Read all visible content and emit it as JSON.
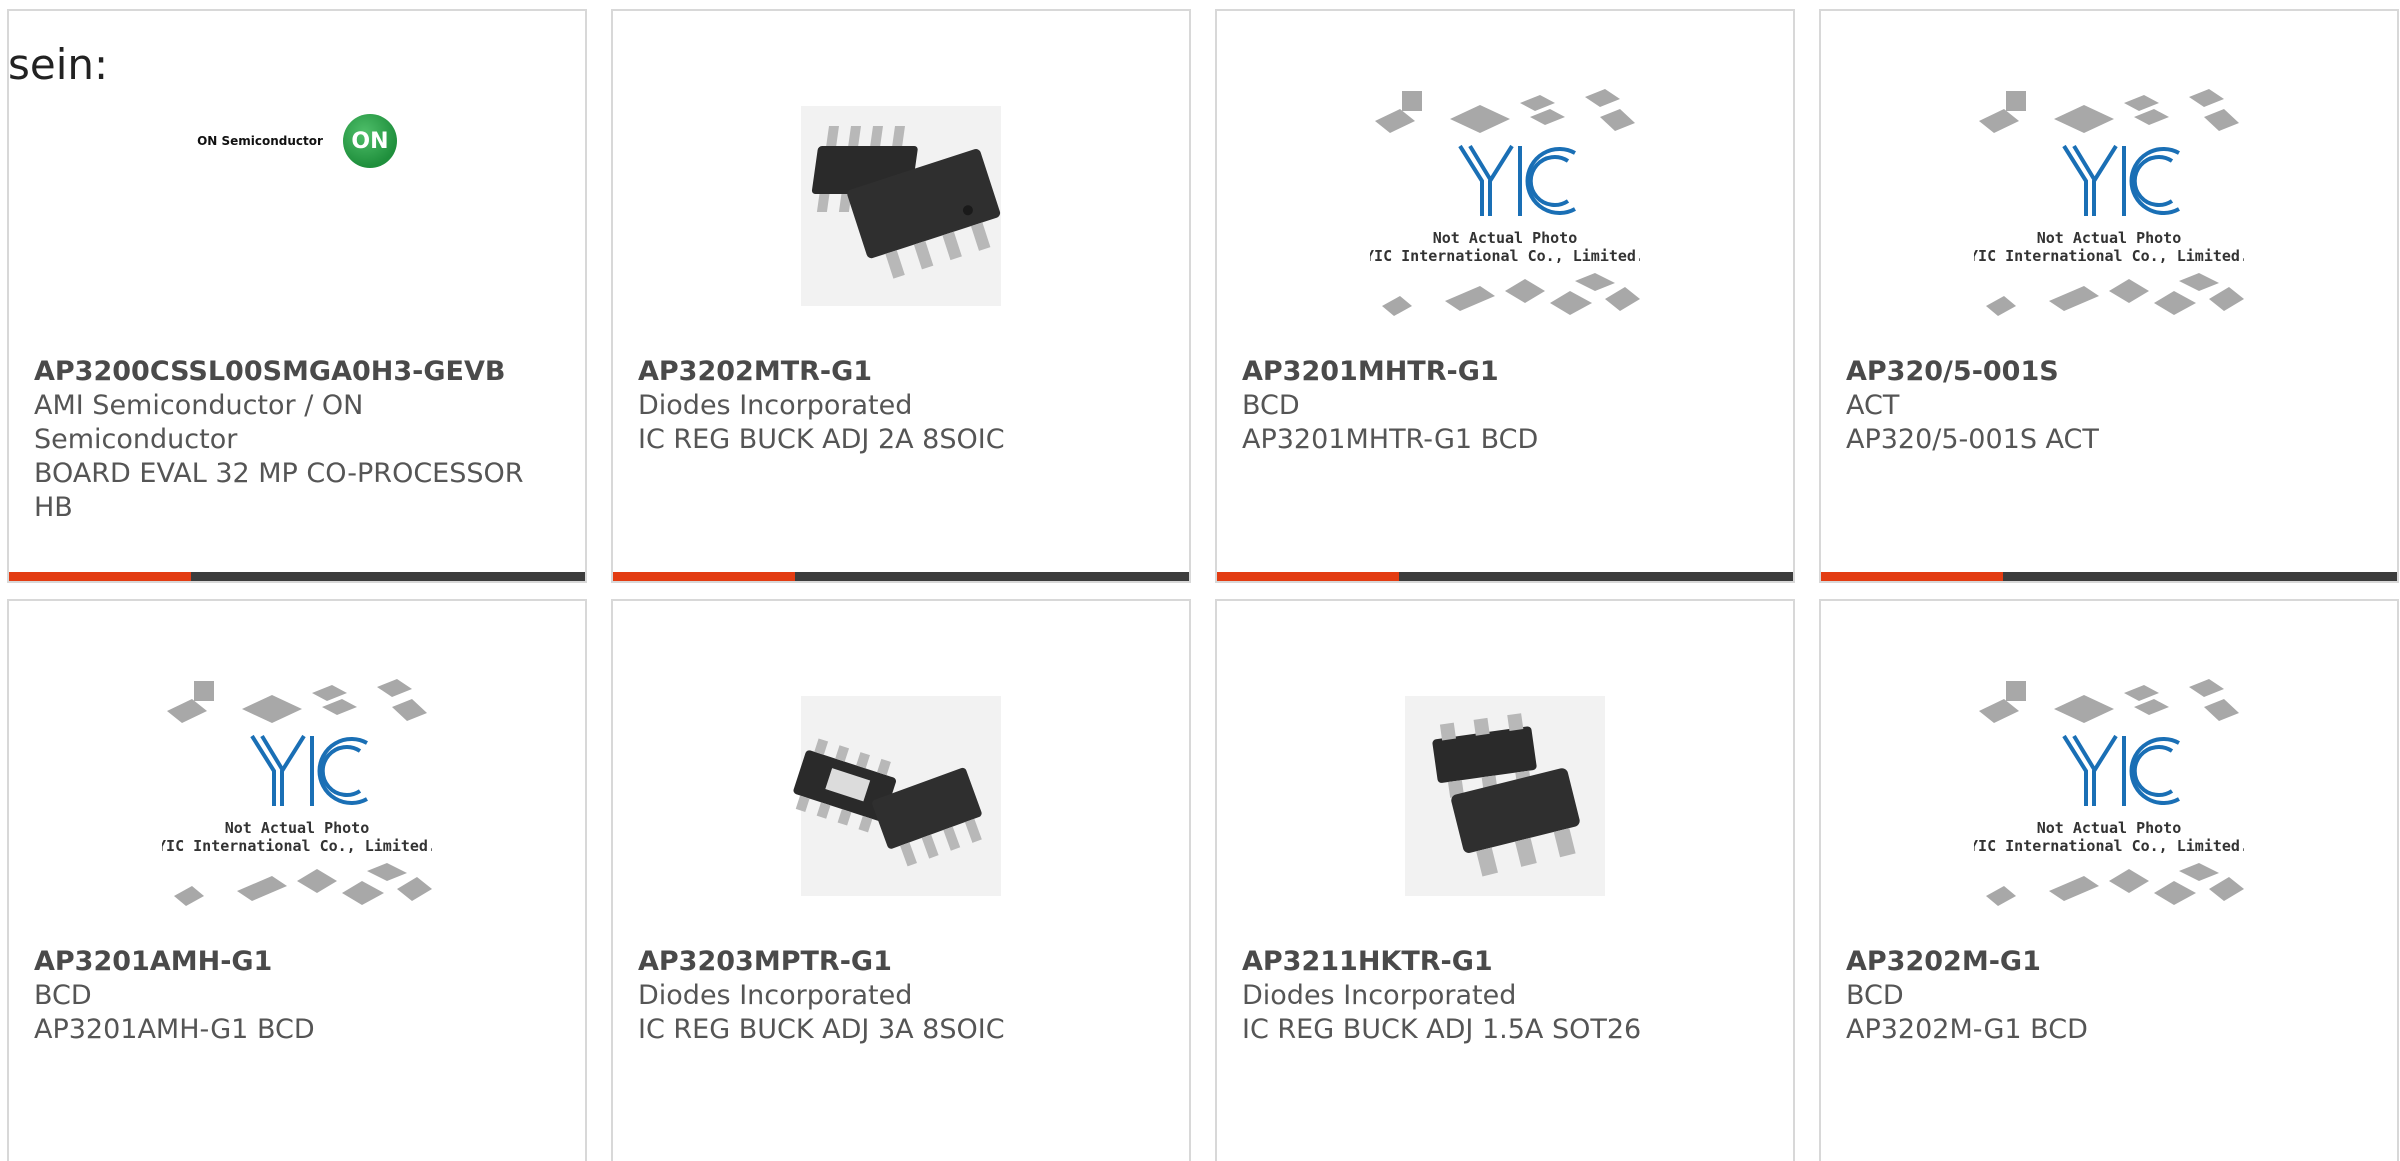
{
  "intro_text": "sein:",
  "placeholder": {
    "line1": "Not Actual Photo",
    "line2": "YIC International Co., Limited."
  },
  "on_logo": {
    "wordmark": "ON Semiconductor",
    "badge": "ON"
  },
  "colors": {
    "accent": "#e33c12",
    "bar": "#3c3c3c",
    "border": "#d8d8d8",
    "text": "#555555",
    "yic_blue": "#1a6fb5"
  },
  "products": [
    {
      "part_number": "AP3200CSSL00SMGA0H3-GEVB",
      "manufacturer": "AMI Semiconductor / ON Semiconductor",
      "description": "BOARD EVAL 32 MP CO-PROCESSOR HB",
      "image": "on-semiconductor-logo"
    },
    {
      "part_number": "AP3202MTR-G1",
      "manufacturer": "Diodes Incorporated",
      "description": "IC REG BUCK ADJ 2A 8SOIC",
      "image": "soic8-chip-photo"
    },
    {
      "part_number": "AP3201MHTR-G1",
      "manufacturer": "BCD",
      "description": "AP3201MHTR-G1 BCD",
      "image": "yic-placeholder"
    },
    {
      "part_number": "AP320/5-001S",
      "manufacturer": "ACT",
      "description": "AP320/5-001S ACT",
      "image": "yic-placeholder"
    },
    {
      "part_number": "AP3201AMH-G1",
      "manufacturer": "BCD",
      "description": "AP3201AMH-G1 BCD",
      "image": "yic-placeholder"
    },
    {
      "part_number": "AP3203MPTR-G1",
      "manufacturer": "Diodes Incorporated",
      "description": "IC REG BUCK ADJ 3A 8SOIC",
      "image": "soic8-chip-photo"
    },
    {
      "part_number": "AP3211HKTR-G1",
      "manufacturer": "Diodes Incorporated",
      "description": "IC REG BUCK ADJ 1.5A SOT26",
      "image": "sot26-chip-photo"
    },
    {
      "part_number": "AP3202M-G1",
      "manufacturer": "BCD",
      "description": "AP3202M-G1 BCD",
      "image": "yic-placeholder"
    }
  ]
}
